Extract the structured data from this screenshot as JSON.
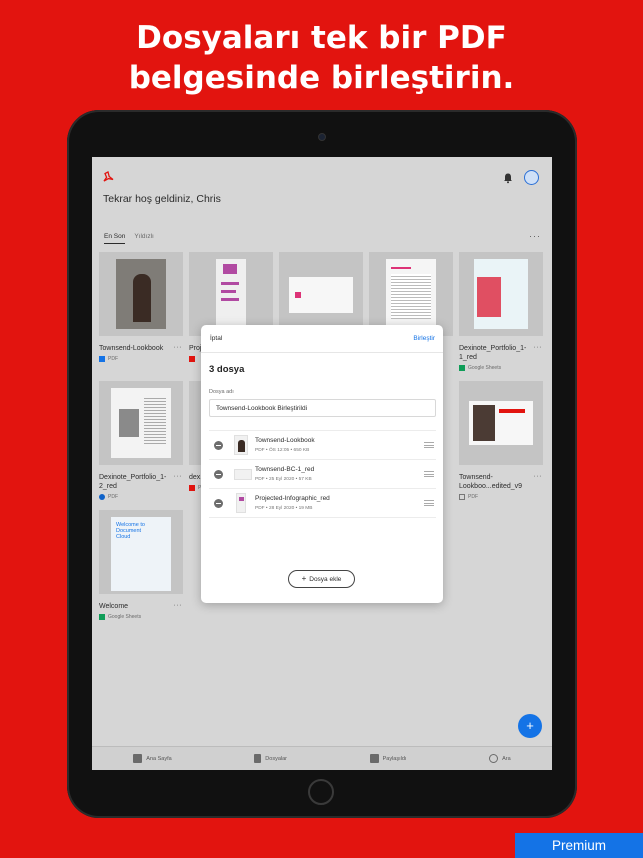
{
  "headline": {
    "line1": "Dosyaları tek bir PDF",
    "line2": "belgesinde birleştirin."
  },
  "app": {
    "welcome": "Tekrar hoş geldiniz, Chris",
    "tabs": [
      "En Son",
      "Yıldızlı"
    ],
    "more": "···"
  },
  "cards": [
    {
      "title": "Townsend-Lookbook",
      "meta": "PDF",
      "source_icon": "dropbox-icon"
    },
    {
      "title": "Proj... Info...",
      "meta": "",
      "source_icon": "pdf-icon"
    },
    {
      "title": "",
      "meta": "",
      "source_icon": ""
    },
    {
      "title": "",
      "meta": "",
      "source_icon": ""
    },
    {
      "title": "Dexinote_Portfolio_1-1_red",
      "meta": "Google Sheets",
      "source_icon": "google-sheets-icon"
    },
    {
      "title": "Dexinote_Portfolio_1-2_red",
      "meta": "PDF",
      "source_icon": "onedrive-icon"
    },
    {
      "title": "dex... proj...",
      "meta": "P",
      "source_icon": "pdf-icon"
    },
    {
      "title": "",
      "meta": "",
      "source_icon": ""
    },
    {
      "title": "",
      "meta": "",
      "source_icon": ""
    },
    {
      "title": "Townsend-Lookboo...edited_v9",
      "meta": "PDF",
      "source_icon": "file-icon"
    },
    {
      "title": "Welcome",
      "meta": "Google Sheets",
      "source_icon": "google-sheets-icon"
    }
  ],
  "modal": {
    "cancel": "İptal",
    "merge": "Birleştir",
    "count": "3 dosya",
    "name_label": "Dosya adı",
    "name_value": "Townsend-Lookbook Birleştirildi",
    "files": [
      {
        "name": "Townsend-Lookbook",
        "meta": "PDF  •  ÖS 12:05  •  650 KB"
      },
      {
        "name": "Townsend-BC-1_red",
        "meta": "PDF  •  25 Eyl 2020  •  57 KB"
      },
      {
        "name": "Projected-Infographic_red",
        "meta": "PDF  •  28 Eyl 2020  •  19 MB"
      }
    ],
    "add_file": "Dosya ekle"
  },
  "nav": {
    "home": "Ana Sayfa",
    "files": "Dosyalar",
    "shared": "Paylaşıldı",
    "search": "Ara"
  },
  "welcome_card_text": "Welcome to Document Cloud",
  "premium": "Premium",
  "colors": {
    "background": "#e2140f",
    "accent": "#1473e6"
  }
}
